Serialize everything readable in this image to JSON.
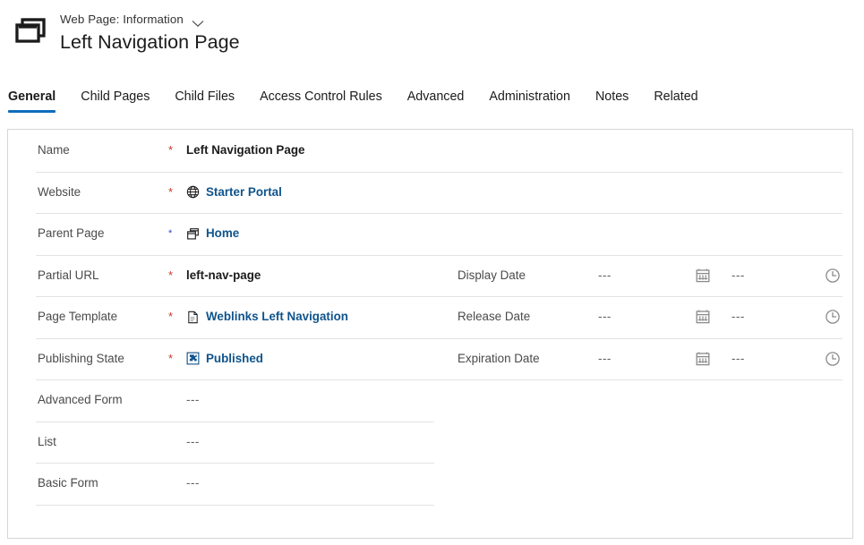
{
  "header": {
    "logo_icon": "web-pages-stack-icon",
    "breadcrumb": "Web Page: Information",
    "breadcrumb_chevron_icon": "chevron-down-icon",
    "title": "Left Navigation Page"
  },
  "tabs": [
    {
      "label": "General",
      "active": true
    },
    {
      "label": "Child Pages",
      "active": false
    },
    {
      "label": "Child Files",
      "active": false
    },
    {
      "label": "Access Control Rules",
      "active": false
    },
    {
      "label": "Advanced",
      "active": false
    },
    {
      "label": "Administration",
      "active": false
    },
    {
      "label": "Notes",
      "active": false
    },
    {
      "label": "Related",
      "active": false
    }
  ],
  "colors": {
    "accent": "#0f6cbd",
    "link": "#0f548c",
    "required": "#c8372d",
    "required_alt": "#2b44c7",
    "divider": "#e3e3e3",
    "card_border": "#d6d6d6"
  },
  "form": {
    "left_fields": [
      {
        "label": "Name",
        "required": true,
        "required_style": "red",
        "value": "Left Navigation Page",
        "value_type": "text",
        "icon": null
      },
      {
        "label": "Website",
        "required": true,
        "required_style": "red",
        "value": "Starter Portal",
        "value_type": "link",
        "icon": "globe-icon"
      },
      {
        "label": "Parent Page",
        "required": true,
        "required_style": "blue",
        "value": "Home",
        "value_type": "link",
        "icon": "web-pages-stack-icon"
      },
      {
        "label": "Partial URL",
        "required": true,
        "required_style": "red",
        "value": "left-nav-page",
        "value_type": "text",
        "icon": null
      },
      {
        "label": "Page Template",
        "required": true,
        "required_style": "red",
        "value": "Weblinks Left Navigation",
        "value_type": "link",
        "icon": "document-icon"
      },
      {
        "label": "Publishing State",
        "required": true,
        "required_style": "red",
        "value": "Published",
        "value_type": "link",
        "icon": "puzzle-box-icon"
      },
      {
        "label": "Advanced Form",
        "required": false,
        "required_style": null,
        "value": "---",
        "value_type": "empty",
        "icon": null
      },
      {
        "label": "List",
        "required": false,
        "required_style": null,
        "value": "---",
        "value_type": "empty",
        "icon": null
      },
      {
        "label": "Basic Form",
        "required": false,
        "required_style": null,
        "value": "---",
        "value_type": "empty",
        "icon": null
      }
    ],
    "right_fields": [
      {
        "label": "Display Date",
        "date_value": "---",
        "time_value": "---",
        "calendar_icon": "calendar-icon",
        "clock_icon": "clock-icon"
      },
      {
        "label": "Release Date",
        "date_value": "---",
        "time_value": "---",
        "calendar_icon": "calendar-icon",
        "clock_icon": "clock-icon"
      },
      {
        "label": "Expiration Date",
        "date_value": "---",
        "time_value": "---",
        "calendar_icon": "calendar-icon",
        "clock_icon": "clock-icon"
      }
    ]
  }
}
